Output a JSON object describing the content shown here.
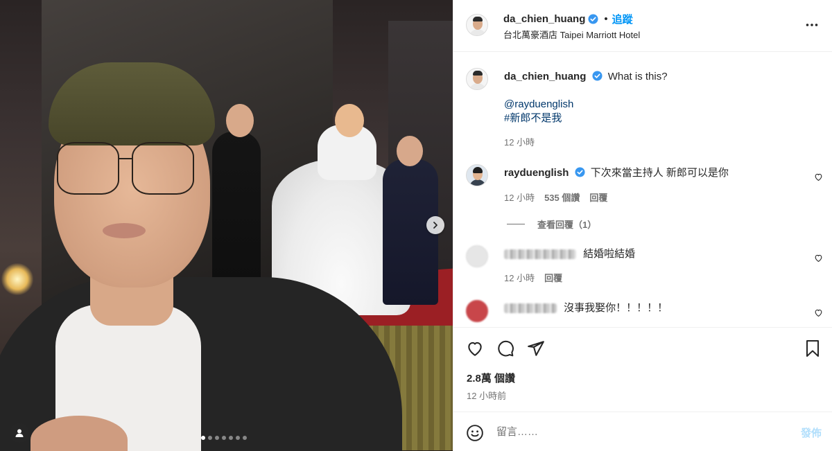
{
  "header": {
    "username": "da_chien_huang",
    "separator": "•",
    "follow_label": "追蹤",
    "location": "台北萬豪酒店 Taipei Marriott Hotel"
  },
  "caption": {
    "username": "da_chien_huang",
    "text": "What is this?",
    "mention": "@rayduenglish",
    "hashtag": "#新郎不是我",
    "time": "12 小時"
  },
  "comments": [
    {
      "username": "rayduenglish",
      "text": "下次來當主持人 新郎可以是你",
      "time": "12 小時",
      "likes": "535 個讚",
      "reply_label": "回覆",
      "view_replies": "查看回覆（1）"
    },
    {
      "username": "",
      "text": "結婚啦結婚",
      "time": "12 小時",
      "reply_label": "回覆"
    },
    {
      "username": "",
      "text": "沒事我娶你！！！！！"
    }
  ],
  "stats": {
    "views": "2.8萬 個讚",
    "posted": "12 小時前"
  },
  "composer": {
    "placeholder": "留言……",
    "post_label": "發佈"
  },
  "carousel": {
    "total": 7,
    "active": 0
  },
  "colors": {
    "link_blue": "#0095f6",
    "verified_blue": "#3897f0",
    "mention_blue": "#00376b",
    "post_disabled": "#b2dffc",
    "muted": "#737373"
  },
  "icons": [
    "verified-badge-icon",
    "more-options-icon",
    "heart-icon",
    "comment-icon",
    "share-icon",
    "bookmark-icon",
    "emoji-icon",
    "chevron-right-icon",
    "tagged-user-icon"
  ]
}
